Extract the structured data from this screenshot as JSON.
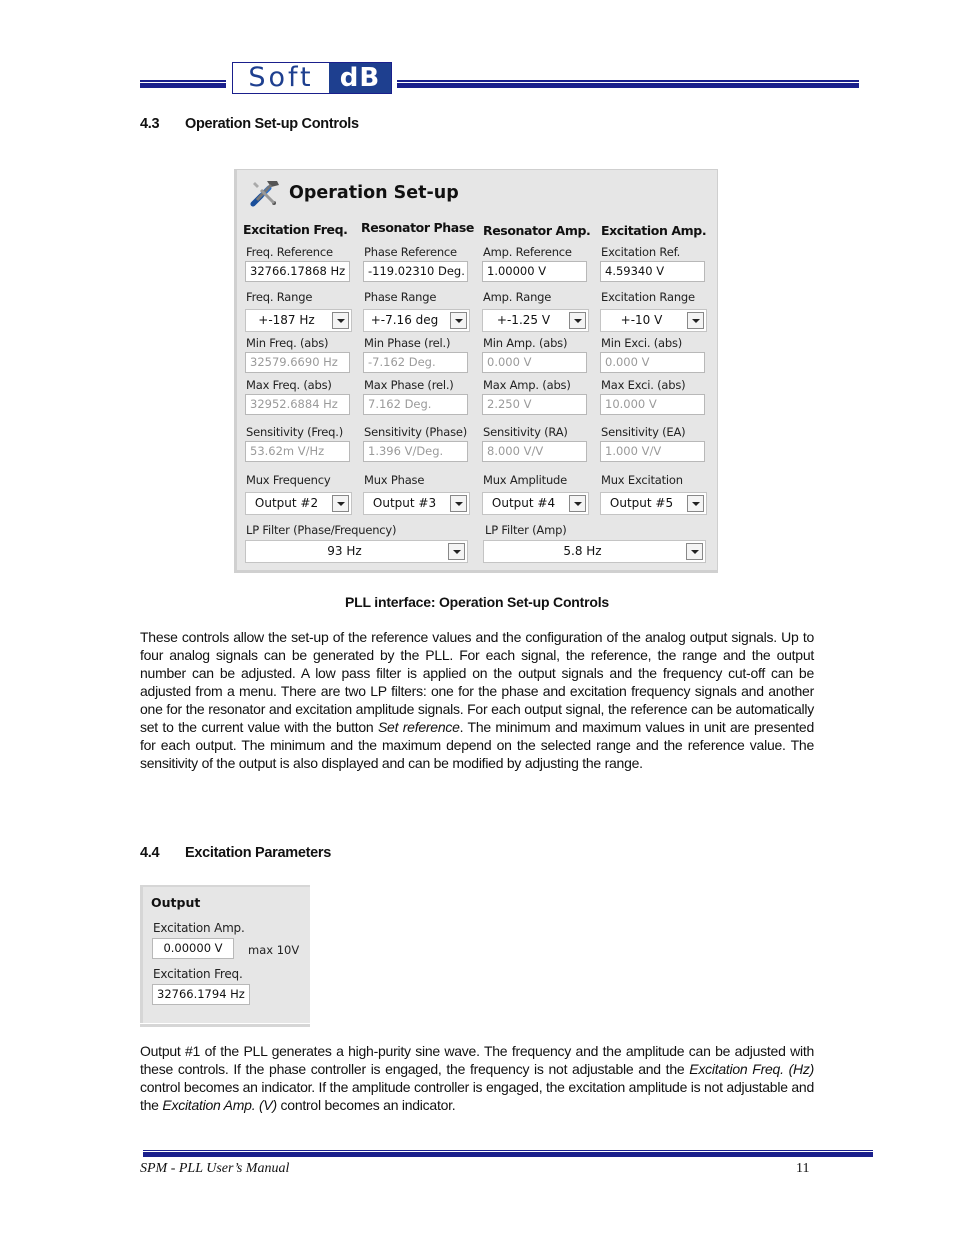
{
  "header": {
    "logo_left": "Soft",
    "logo_right": "dB"
  },
  "section_43": {
    "number": "4.3",
    "title": "Operation Set-up Controls"
  },
  "operation_setup": {
    "title": "Operation Set-up",
    "icon": "tools-icon",
    "columns": [
      {
        "heading": "Excitation Freq.",
        "reference_label": "Freq. Reference",
        "reference_value": "32766.17868 Hz",
        "range_label": "Freq. Range",
        "range_value": "+-187 Hz",
        "min_label": "Min Freq. (abs)",
        "min_value": "32579.6690 Hz",
        "max_label": "Max Freq. (abs)",
        "max_value": "32952.6884 Hz",
        "sensitivity_label": "Sensitivity (Freq.)",
        "sensitivity_value": "53.62m V/Hz",
        "mux_label": "Mux Frequency",
        "mux_value": "Output #2"
      },
      {
        "heading": "Resonator Phase",
        "reference_label": "Phase Reference",
        "reference_value": "-119.02310 Deg.",
        "range_label": "Phase Range",
        "range_value": "+-7.16 deg",
        "min_label": "Min Phase (rel.)",
        "min_value": "-7.162 Deg.",
        "max_label": "Max Phase (rel.)",
        "max_value": "7.162 Deg.",
        "sensitivity_label": "Sensitivity (Phase)",
        "sensitivity_value": "1.396 V/Deg.",
        "mux_label": "Mux Phase",
        "mux_value": "Output #3"
      },
      {
        "heading": "Resonator Amp.",
        "reference_label": "Amp. Reference",
        "reference_value": "1.00000 V",
        "range_label": "Amp. Range",
        "range_value": "+-1.25 V",
        "min_label": "Min Amp. (abs)",
        "min_value": "0.000 V",
        "max_label": "Max Amp. (abs)",
        "max_value": "2.250 V",
        "sensitivity_label": "Sensitivity (RA)",
        "sensitivity_value": "8.000 V/V",
        "mux_label": "Mux Amplitude",
        "mux_value": "Output #4"
      },
      {
        "heading": "Excitation Amp.",
        "reference_label": "Excitation Ref.",
        "reference_value": "4.59340 V",
        "range_label": "Excitation Range",
        "range_value": "+-10 V",
        "min_label": "Min Exci. (abs)",
        "min_value": "0.000 V",
        "max_label": "Max Exci. (abs)",
        "max_value": "10.000 V",
        "sensitivity_label": "Sensitivity (EA)",
        "sensitivity_value": "1.000 V/V",
        "mux_label": "Mux Excitation",
        "mux_value": "Output #5"
      }
    ],
    "lp_filters": [
      {
        "label": "LP Filter (Phase/Frequency)",
        "value": "93 Hz"
      },
      {
        "label": "LP Filter (Amp)",
        "value": "5.8 Hz"
      }
    ]
  },
  "caption_43": "PLL interface: Operation Set-up Controls",
  "para_43": {
    "part1": "These controls allow the set-up of the reference values and the configuration of the analog output signals. Up to four analog signals can be generated by the PLL. For each signal, the reference, the range and the output number can be adjusted. A low pass filter is applied on the output signals and the frequency cut-off can be adjusted from a menu. There are two LP filters: one for the phase and excitation frequency signals and another one for the resonator and excitation amplitude signals. For each output signal, the reference can be automatically set to the current value with the button ",
    "italic1": "Set reference",
    "part2": ". The minimum and maximum values in unit are presented for each output. The minimum and the maximum depend on the selected range and the reference value. The sensitivity of the output is also displayed and can be modified by adjusting the range."
  },
  "section_44": {
    "number": "4.4",
    "title": "Excitation Parameters"
  },
  "output_panel": {
    "title": "Output",
    "amp_label": "Excitation Amp.",
    "amp_value": "0.00000 V",
    "amp_max": "max 10V",
    "freq_label": "Excitation Freq.",
    "freq_value": "32766.1794 Hz"
  },
  "para_44": {
    "part1": "Output #1 of the PLL generates a high-purity sine wave. The frequency and the amplitude can be adjusted with these controls. If the phase controller is engaged, the frequency is not adjustable and the ",
    "italic1": "Excitation Freq. (Hz)",
    "part2": " control becomes an indicator. If the amplitude controller is engaged, the excitation amplitude is not adjustable and the ",
    "italic2": "Excitation Amp. (V)",
    "part3": " control becomes an indicator."
  },
  "footer": {
    "title": "SPM - PLL User’s Manual",
    "page": "11"
  }
}
